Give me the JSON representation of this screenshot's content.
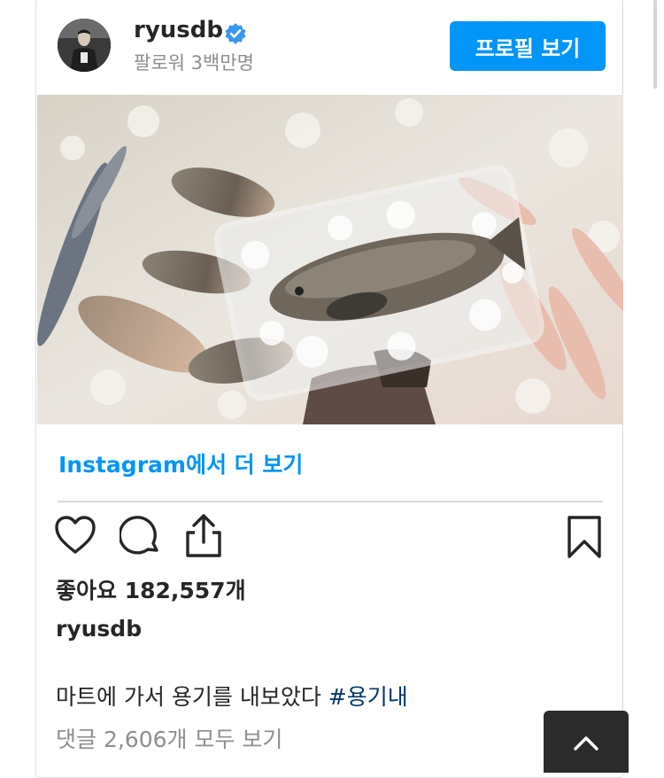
{
  "post": {
    "username": "ryusdb",
    "followers": "팔로워 3백만명",
    "profile_button": "프로필 보기",
    "view_more": "Instagram에서 더 보기",
    "likes": "좋아요 182,557개",
    "caption_username": "ryusdb",
    "caption_text": "마트에 가서 용기를 내보았다 ",
    "caption_hashtag": "#용기내",
    "comments_link": "댓글 2,606개 모두 보기"
  },
  "icons": {
    "verified": "verified-badge-icon",
    "like": "heart-icon",
    "comment": "comment-bubble-icon",
    "share": "share-icon",
    "save": "bookmark-icon",
    "scroll_top": "chevron-up-icon"
  },
  "colors": {
    "accent": "#0095f6",
    "text": "#262626",
    "muted": "#8e8e8e",
    "hashtag": "#00376b",
    "floating_button": "#2b2b2b"
  }
}
